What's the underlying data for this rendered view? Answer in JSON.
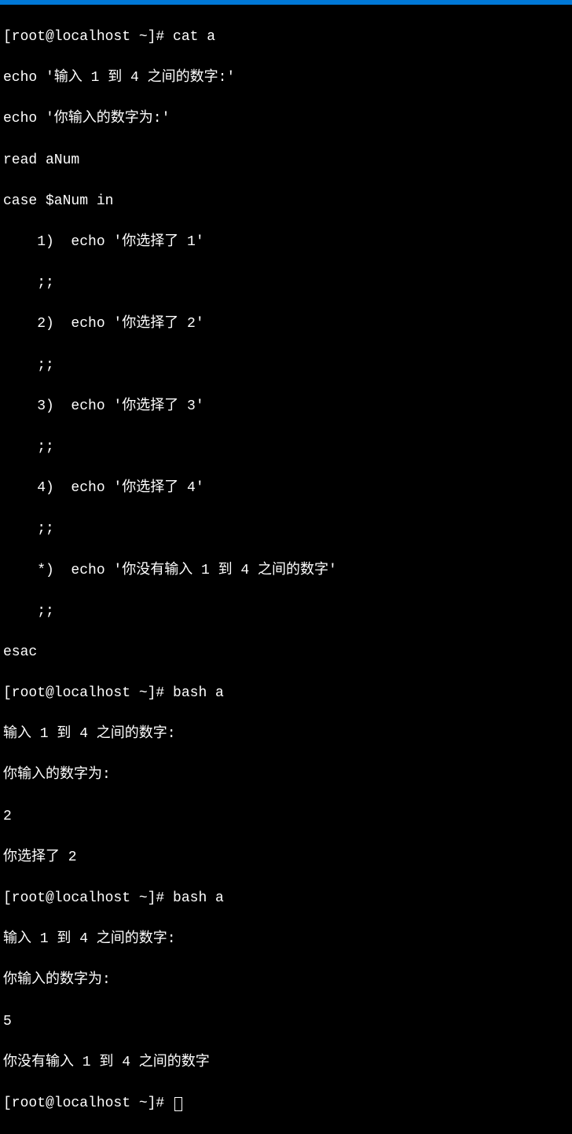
{
  "prompt_prefix": "[root@localhost ~]# ",
  "commands": {
    "cat": "cat a",
    "bash": "bash a"
  },
  "script": {
    "l1": "echo '输入 1 到 4 之间的数字:'",
    "l2": "echo '你输入的数字为:'",
    "l3": "read aNum",
    "l4": "case $aNum in",
    "l5": "    1)  echo '你选择了 1'",
    "l6": "    ;;",
    "l7": "    2)  echo '你选择了 2'",
    "l8": "    ;;",
    "l9": "    3)  echo '你选择了 3'",
    "l10": "    ;;",
    "l11": "    4)  echo '你选择了 4'",
    "l12": "    ;;",
    "l13": "    *)  echo '你没有输入 1 到 4 之间的数字'",
    "l14": "    ;;",
    "l15": "esac"
  },
  "run1": {
    "out1": "输入 1 到 4 之间的数字:",
    "out2": "你输入的数字为:",
    "input": "2",
    "out3": "你选择了 2"
  },
  "run2": {
    "out1": "输入 1 到 4 之间的数字:",
    "out2": "你输入的数字为:",
    "input": "5",
    "out3": "你没有输入 1 到 4 之间的数字"
  }
}
